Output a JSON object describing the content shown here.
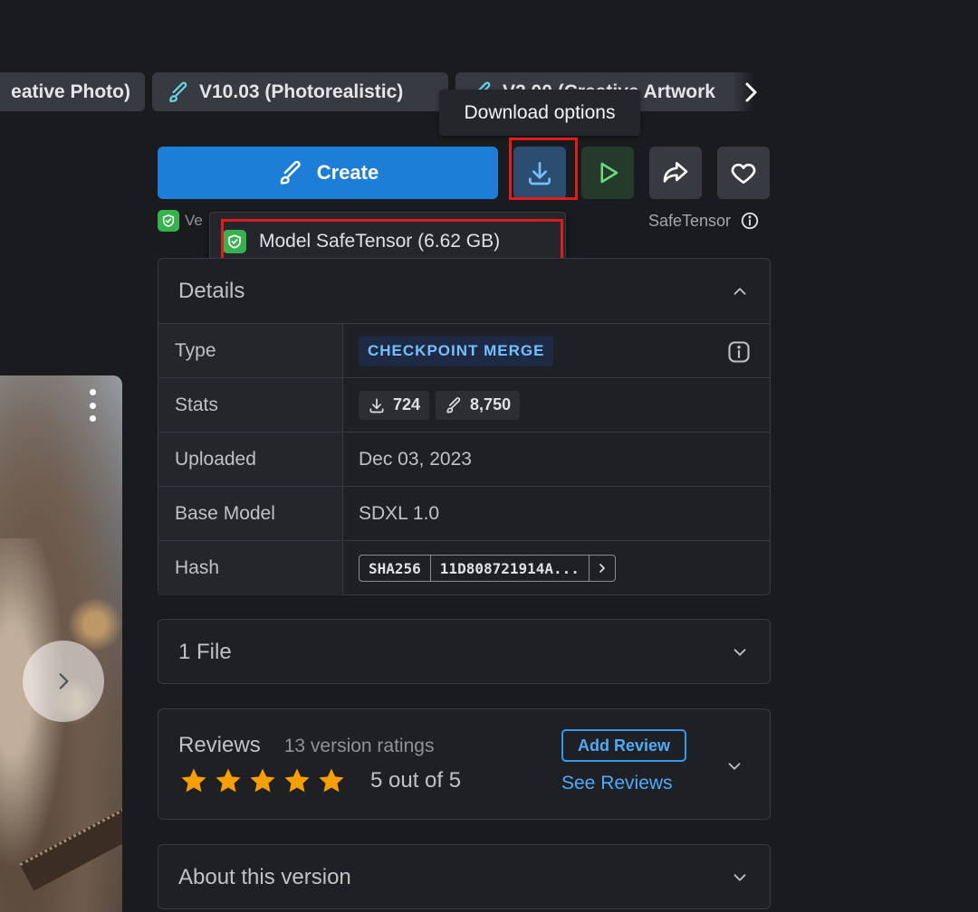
{
  "versions": [
    {
      "label": "eative Photo)"
    },
    {
      "label": "V10.03 (Photorealistic)"
    },
    {
      "label": "V2.00 (Creative Artwork"
    }
  ],
  "tooltip": {
    "text": "Download options"
  },
  "actions": {
    "create_label": "Create",
    "download_icon": "download-icon",
    "play_icon": "play-icon",
    "share_icon": "share-icon",
    "favorite_icon": "heart-icon"
  },
  "verified": {
    "label": "Ve"
  },
  "safetensor": {
    "label": "SafeTensor"
  },
  "download_menu": {
    "items": [
      {
        "label": "Model SafeTensor (6.62 GB)"
      }
    ]
  },
  "details": {
    "title": "Details",
    "rows": {
      "type": {
        "label": "Type",
        "value": "CHECKPOINT MERGE"
      },
      "stats": {
        "label": "Stats",
        "downloads": "724",
        "generations": "8,750"
      },
      "uploaded": {
        "label": "Uploaded",
        "value": "Dec 03, 2023"
      },
      "base_model": {
        "label": "Base Model",
        "value": "SDXL 1.0"
      },
      "hash": {
        "label": "Hash",
        "algo": "SHA256",
        "value": "11D808721914A..."
      }
    }
  },
  "files": {
    "title": "1 File"
  },
  "reviews": {
    "title": "Reviews",
    "count_text": "13 version ratings",
    "rating": 5,
    "rating_text": "5 out of 5",
    "add_label": "Add Review",
    "see_label": "See Reviews"
  },
  "about": {
    "title": "About this version"
  },
  "colors": {
    "accent": "#1c7ed6",
    "highlight": "#e01c1c",
    "star": "#f59f00",
    "verified": "#37b24d"
  }
}
